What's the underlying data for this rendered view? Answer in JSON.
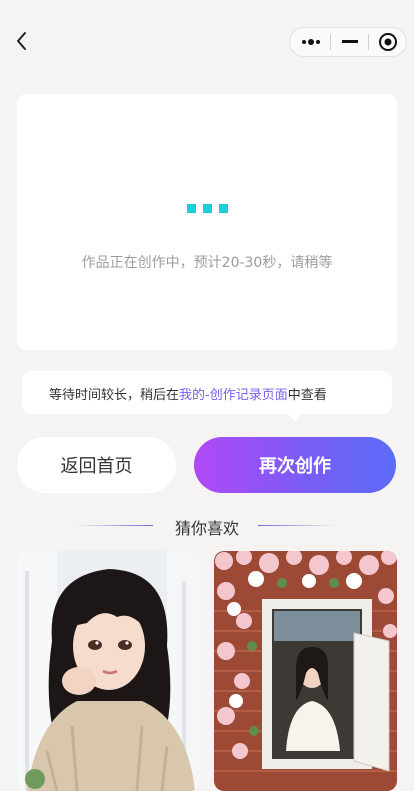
{
  "nav": {
    "back_icon": "chevron-left-icon",
    "capsule_icons": [
      "more-dots-icon",
      "minimize-icon",
      "close-target-icon"
    ]
  },
  "loading": {
    "text": "作品正在创作中，预计20-30秒，请稍等",
    "dot_color": "#1bcfd6"
  },
  "tip": {
    "prefix": "等待时间较长，稍后在",
    "link": "我的-创作记录页面",
    "suffix": "中查看"
  },
  "actions": {
    "home_label": "返回首页",
    "again_label": "再次创作",
    "gradient": [
      "#b049f6",
      "#5b6cf7"
    ]
  },
  "recommend": {
    "title": "猜你喜欢",
    "items": [
      {
        "image": "anime-girl-portrait"
      },
      {
        "image": "girl-in-rose-window"
      }
    ]
  }
}
